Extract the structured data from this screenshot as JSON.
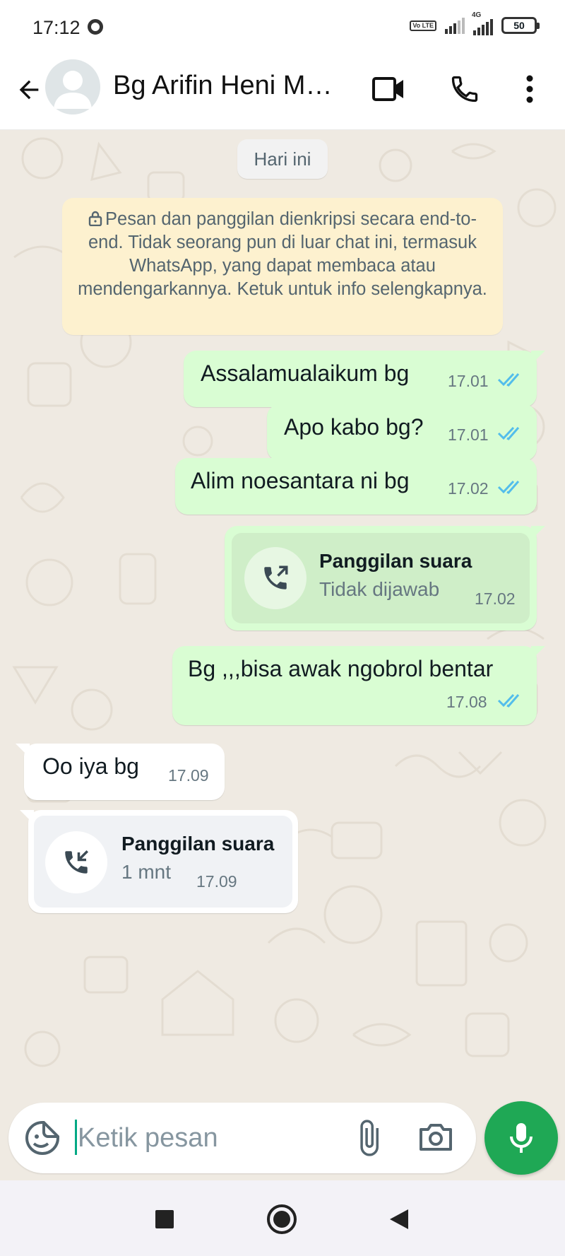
{
  "status_bar": {
    "time": "17:12",
    "network": "4G",
    "volte": "Vo LTE",
    "battery": "50"
  },
  "header": {
    "contact_name": "Bg Arifin Heni Mar..."
  },
  "chat": {
    "date_chip": "Hari ini",
    "encryption_notice": "Pesan dan panggilan dienkripsi secara end-to-end. Tidak seorang pun di luar chat ini, termasuk WhatsApp, yang dapat membaca atau mendengarkannya. Ketuk untuk info selengkapnya.",
    "messages": [
      {
        "direction": "out",
        "type": "text",
        "text": "Assalamualaikum bg",
        "time": "17.01",
        "status": "read"
      },
      {
        "direction": "out",
        "type": "text",
        "text": "Apo kabo bg?",
        "time": "17.01",
        "status": "read"
      },
      {
        "direction": "out",
        "type": "text",
        "text": "Alim noesantara ni bg",
        "time": "17.02",
        "status": "read"
      },
      {
        "direction": "out",
        "type": "call",
        "title": "Panggilan suara",
        "subtitle": "Tidak dijawab",
        "time": "17.02"
      },
      {
        "direction": "out",
        "type": "text",
        "text": "Bg ,,,bisa awak ngobrol bentar",
        "time": "17.08",
        "status": "read"
      },
      {
        "direction": "in",
        "type": "text",
        "text": "Oo iya bg",
        "time": "17.09"
      },
      {
        "direction": "in",
        "type": "call",
        "title": "Panggilan suara",
        "subtitle": "1 mnt",
        "time": "17.09"
      }
    ]
  },
  "input": {
    "placeholder": "Ketik pesan"
  },
  "icons": {
    "back": "arrow-left-icon",
    "video": "video-call-icon",
    "call": "phone-icon",
    "menu": "more-vertical-icon",
    "sticker": "sticker-icon",
    "attach": "paperclip-icon",
    "camera": "camera-icon",
    "mic": "mic-icon"
  },
  "colors": {
    "outgoing_bubble": "#d9fdd3",
    "incoming_bubble": "#ffffff",
    "chat_background": "#efeae2",
    "read_ticks": "#53bdeb",
    "mic_button": "#1fa855",
    "encryption_box": "#fdf1cf"
  }
}
